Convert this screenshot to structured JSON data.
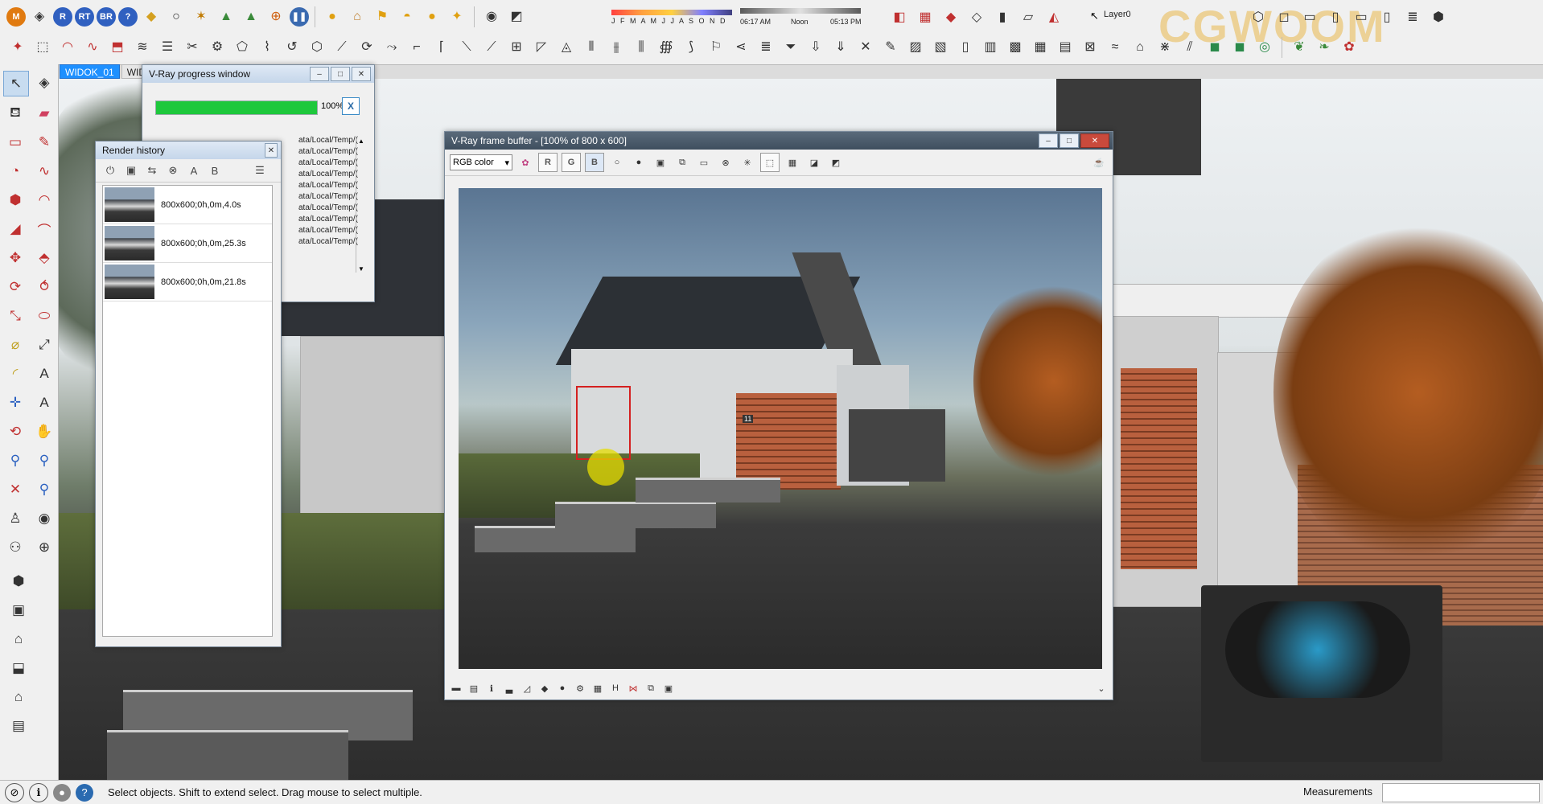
{
  "toolbar_top": {
    "row1_icons": [
      "m-ruby-icon",
      "tag-icon",
      "r-icon",
      "rt-icon",
      "br-icon",
      "help-icon",
      "label-icon",
      "sphere-icon",
      "section-icon",
      "terrain-icon",
      "terrain2-icon",
      "target-icon",
      "pause-icon",
      "light-icon",
      "house-light-icon",
      "flag-icon",
      "dome-icon",
      "sun-icon",
      "wand-icon",
      "camera-icon",
      "eraser-icon"
    ],
    "row1_circle_labels": {
      "m": "M",
      "r": "R",
      "rt": "RT",
      "br": "BR",
      "help": "?"
    },
    "months_label": "J F M A M J J A S O N D",
    "time_start": "06:17 AM",
    "time_noon": "Noon",
    "time_end": "05:13 PM",
    "layer": "Layer0",
    "watermark": "CGWOOM"
  },
  "scene_tabs": [
    {
      "label": "WIDOK_01",
      "active": true
    },
    {
      "label": "WIDO",
      "active": false
    }
  ],
  "progress_window": {
    "title": "V-Ray progress window",
    "progress": 100,
    "progress_label": "100%",
    "cancel_label": "X",
    "log_lines": [
      "ata/Local/Temp/(",
      "ata/Local/Temp/(",
      "ata/Local/Temp/(",
      "ata/Local/Temp/(",
      "ata/Local/Temp/(",
      "ata/Local/Temp/(",
      "ata/Local/Temp/(",
      "ata/Local/Temp/(",
      "ata/Local/Temp/(",
      "ata/Local/Temp/("
    ]
  },
  "render_history": {
    "title": "Render history",
    "items": [
      {
        "label": "800x600;0h,0m,4.0s"
      },
      {
        "label": "800x600;0h,0m,25.3s"
      },
      {
        "label": "800x600;0h,0m,21.8s"
      }
    ],
    "tool_a": "A",
    "tool_b": "B"
  },
  "frame_buffer": {
    "title": "V-Ray frame buffer - [100% of 800 x 600]",
    "channel": "RGB color",
    "r_label": "R",
    "g_label": "G",
    "b_label": "B",
    "house_number": "11"
  },
  "window_buttons": {
    "minimize": "–",
    "maximize": "□",
    "close": "✕"
  },
  "statusbar": {
    "text": "Select objects. Shift to extend select. Drag mouse to select multiple.",
    "measurements_label": "Measurements"
  },
  "colors": {
    "accent": "#1e90ff",
    "progress": "#1ec83c"
  }
}
